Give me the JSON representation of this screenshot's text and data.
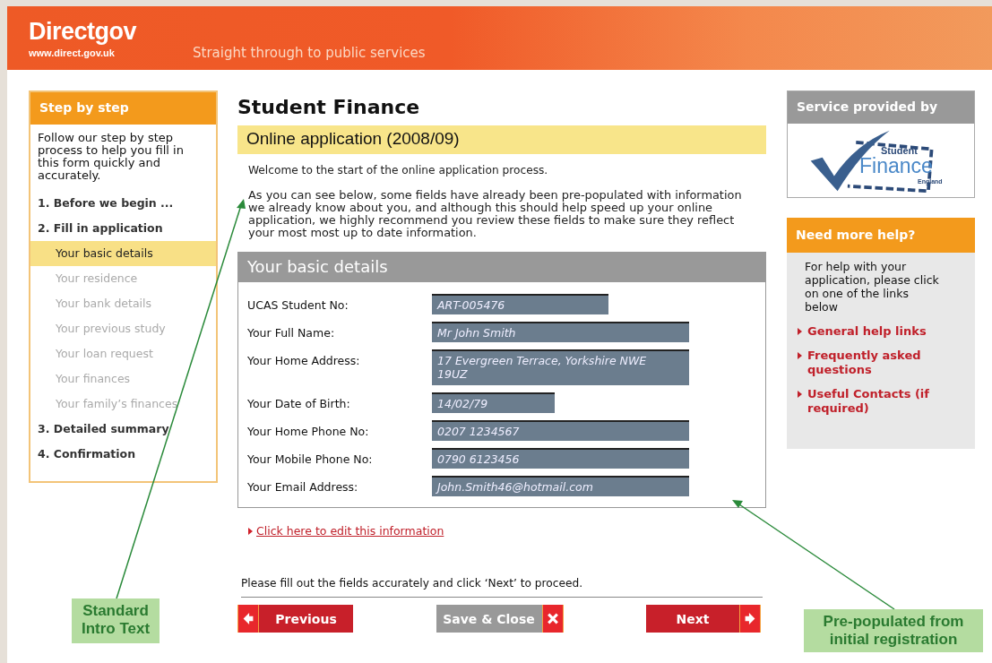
{
  "header": {
    "logo": "Directgov",
    "url": "www.direct.gov.uk",
    "tagline": "Straight through to public services"
  },
  "steps": {
    "title": "Step by step",
    "intro": "Follow our step by step process to help you fill in this form quickly and accurately.",
    "items": [
      {
        "label": "1. Before we begin ...",
        "kind": "step",
        "selected": false,
        "disabled": false
      },
      {
        "label": "2. Fill in application",
        "kind": "step",
        "selected": false,
        "disabled": false
      },
      {
        "label": "Your basic details",
        "kind": "sub",
        "selected": true,
        "disabled": false
      },
      {
        "label": "Your residence",
        "kind": "sub",
        "selected": false,
        "disabled": true
      },
      {
        "label": "Your bank details",
        "kind": "sub",
        "selected": false,
        "disabled": true
      },
      {
        "label": "Your previous study",
        "kind": "sub",
        "selected": false,
        "disabled": true
      },
      {
        "label": "Your loan request",
        "kind": "sub",
        "selected": false,
        "disabled": true
      },
      {
        "label": "Your finances",
        "kind": "sub",
        "selected": false,
        "disabled": true
      },
      {
        "label": "Your family’s finances",
        "kind": "sub",
        "selected": false,
        "disabled": true
      },
      {
        "label": "3. Detailed summary",
        "kind": "step",
        "selected": false,
        "disabled": false
      },
      {
        "label": "4. Confirmation",
        "kind": "step",
        "selected": false,
        "disabled": false
      }
    ]
  },
  "main": {
    "title": "Student Finance",
    "subtitle": "Online application (2008/09)",
    "welcome": "Welcome to the start of the online application process.",
    "intro": "As you can see below, some fields have already been pre-populated with information we already know about you, and although this should help speed up your online application, we highly recommend you review these fields to make sure they reflect your most most up to date information.",
    "section_title": "Your basic details",
    "fields": [
      {
        "label": "UCAS Student No:",
        "value": "ART-005476",
        "kind": "short"
      },
      {
        "label": "Your Full Name:",
        "value": "Mr John Smith",
        "kind": "wide"
      },
      {
        "label": "Your Home Address:",
        "value": "17 Evergreen Terrace, Yorkshire NWE 19UZ",
        "kind": "tall"
      },
      {
        "label": "Your Date of Birth:",
        "value": "14/02/79",
        "kind": "tiny"
      },
      {
        "label": "Your Home Phone No:",
        "value": "0207 1234567",
        "kind": "wide"
      },
      {
        "label": "Your Mobile Phone No:",
        "value": "0790 6123456",
        "kind": "wide"
      },
      {
        "label": "Your Email Address:",
        "value": "John.Smith46@hotmail.com",
        "kind": "wide"
      }
    ],
    "edit_link": "Click here to edit this information",
    "instruction": "Please fill out the fields accurately and click ‘Next’ to proceed.",
    "buttons": [
      {
        "label": "Previous",
        "kind": "previous"
      },
      {
        "label": "Save & Close",
        "kind": "save"
      },
      {
        "label": "Next",
        "kind": "next"
      }
    ]
  },
  "provider": {
    "title": "Service provided by",
    "logo_top": "Student",
    "logo_main": "Finance",
    "logo_bottom": "England"
  },
  "help": {
    "title": "Need more help?",
    "text": "For help with your application, please click on one of the links below",
    "links": [
      "General help links",
      "Frequently asked questions",
      "Useful Contacts (if required)"
    ]
  },
  "annotations": [
    {
      "text": "Standard Intro Text",
      "kind": "left"
    },
    {
      "text": "Pre-populated from initial registration",
      "kind": "right"
    }
  ]
}
